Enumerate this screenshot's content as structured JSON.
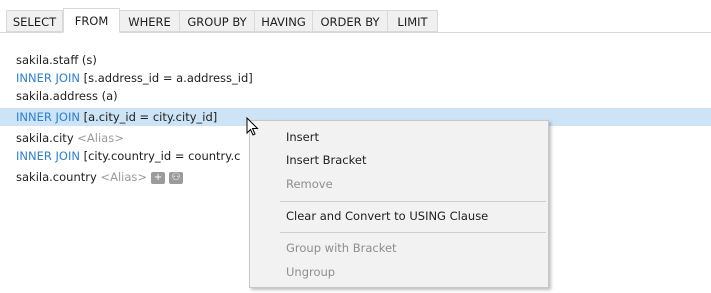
{
  "tabs": [
    {
      "label": "SELECT"
    },
    {
      "label": "FROM"
    },
    {
      "label": "WHERE"
    },
    {
      "label": "GROUP BY"
    },
    {
      "label": "HAVING"
    },
    {
      "label": "ORDER BY"
    },
    {
      "label": "LIMIT"
    }
  ],
  "active_tab": "FROM",
  "lines": {
    "staff": "sakila.staff (s)",
    "join1_kw": "INNER JOIN",
    "join1_cond": " [s.address_id = a.address_id]",
    "address": "sakila.address (a)",
    "join2_kw": "INNER JOIN",
    "join2_cond": " [a.city_id = city.city_id]",
    "city_table": "sakila.city ",
    "city_alias": "<Alias>",
    "join3_kw": "INNER JOIN",
    "join3_cond": " [city.country_id = country.c",
    "country_table": "sakila.country ",
    "country_alias": "<Alias>",
    "add_icon_glyph": "+",
    "columns_icon_glyph": "⚇"
  },
  "context_menu": {
    "insert": "Insert",
    "insert_bracket": "Insert Bracket",
    "remove": "Remove",
    "clear_convert": "Clear and Convert to USING Clause",
    "group_bracket": "Group with Bracket",
    "ungroup": "Ungroup"
  },
  "colors": {
    "keyword": "#2a7fd4",
    "alias_placeholder": "#9a9a9a",
    "selected_row": "#cde4f7",
    "menu_background": "#f2f2f2",
    "disabled_text": "#8e8e8e"
  },
  "icons": [
    "add-table-icon",
    "columns-icon",
    "mouse-cursor-icon"
  ]
}
